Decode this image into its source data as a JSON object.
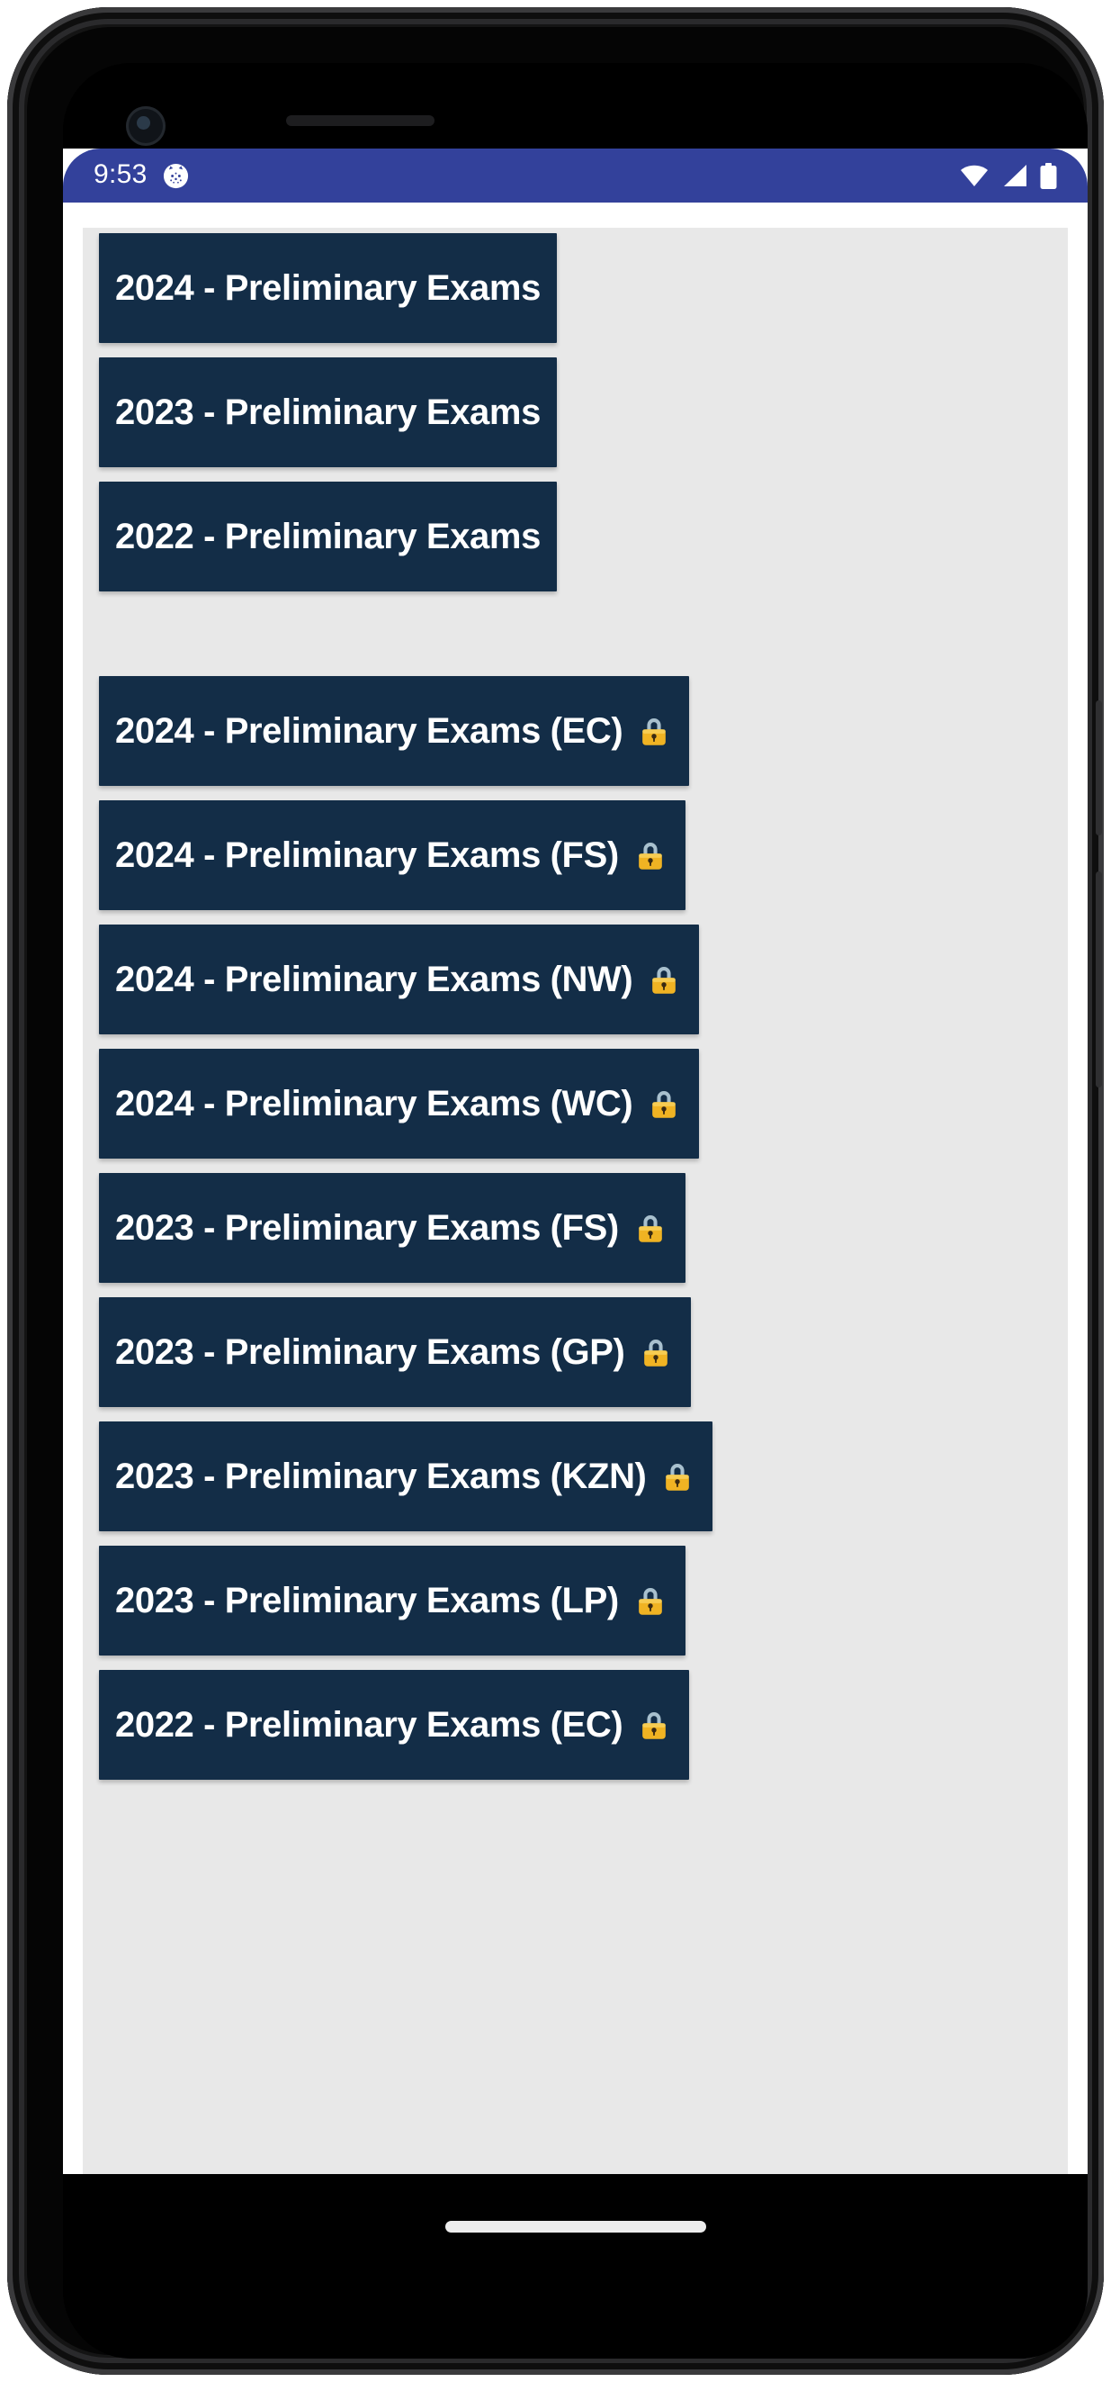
{
  "device": {
    "type": "android-phone-mockup",
    "camera": "front-camera",
    "earpiece": "earpiece-speaker"
  },
  "status_bar": {
    "time": "9:53",
    "background_color": "#33419b",
    "icons": {
      "notification": "cat-face-icon",
      "wifi": "wifi-icon",
      "signal": "cellular-signal-icon",
      "battery": "battery-full-icon"
    }
  },
  "theme": {
    "button_bg": "#132d47",
    "button_text": "#ffffff",
    "panel_bg": "#e8e8e8",
    "page_bg": "#ffffff",
    "lock_body": "#f0b323",
    "lock_shackle": "#a8c0ce"
  },
  "main": {
    "section_primary": [
      {
        "label": "2024 - Preliminary Exams",
        "locked": false
      },
      {
        "label": "2023 - Preliminary Exams",
        "locked": false
      },
      {
        "label": "2022 - Preliminary Exams",
        "locked": false
      }
    ],
    "section_provincial": [
      {
        "label": "2024 - Preliminary Exams (EC)",
        "locked": true
      },
      {
        "label": "2024 - Preliminary Exams (FS)",
        "locked": true
      },
      {
        "label": "2024 - Preliminary Exams (NW)",
        "locked": true
      },
      {
        "label": "2024 - Preliminary Exams (WC)",
        "locked": true
      },
      {
        "label": "2023 - Preliminary Exams (FS)",
        "locked": true
      },
      {
        "label": "2023 - Preliminary Exams (GP)",
        "locked": true
      },
      {
        "label": "2023 - Preliminary Exams (KZN)",
        "locked": true
      },
      {
        "label": "2023 - Preliminary Exams (LP)",
        "locked": true
      },
      {
        "label": "2022 - Preliminary Exams (EC)",
        "locked": true
      }
    ]
  },
  "nav_bar": {
    "gesture_pill": "home-gesture-pill"
  }
}
